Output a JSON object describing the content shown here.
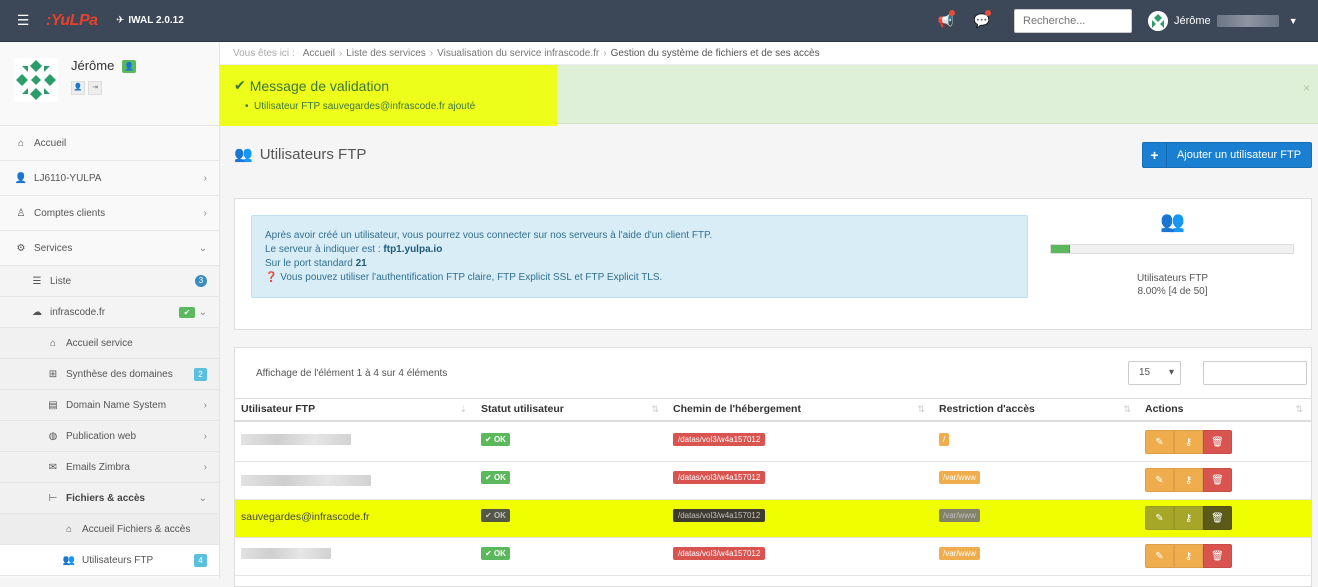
{
  "topbar": {
    "logo_text": ":YuLPa",
    "version": "IWAL 2.0.12",
    "search_placeholder": "Recherche...",
    "user_name": "Jérôme"
  },
  "sidebar": {
    "profile_name": "Jérôme",
    "items": [
      {
        "label": "Accueil",
        "icon": "home-icon"
      },
      {
        "label": "LJ6110-YULPA",
        "icon": "user-icon"
      },
      {
        "label": "Comptes clients",
        "icon": "person-icon"
      },
      {
        "label": "Services",
        "icon": "cogs-icon"
      },
      {
        "label": "Liste",
        "icon": "list-icon",
        "badge": "3"
      },
      {
        "label": "infrascode.fr",
        "icon": "cloud-icon"
      },
      {
        "label": "Accueil service",
        "icon": "home-icon"
      },
      {
        "label": "Synthèse des domaines",
        "icon": "sitemap-icon",
        "badge": "2"
      },
      {
        "label": "Domain Name System",
        "icon": "book-icon"
      },
      {
        "label": "Publication web",
        "icon": "globe-icon"
      },
      {
        "label": "Emails Zimbra",
        "icon": "envelope-icon"
      },
      {
        "label": "Fichiers & accès",
        "icon": "tree-icon"
      },
      {
        "label": "Accueil Fichiers & accès",
        "icon": "home-icon"
      },
      {
        "label": "Utilisateurs FTP",
        "icon": "users-icon",
        "badge": "4"
      }
    ]
  },
  "breadcrumb": {
    "prefix": "Vous êtes ici :",
    "items": [
      "Accueil",
      "Liste des services",
      "Visualisation du service infrascode.fr"
    ],
    "current": "Gestion du système de fichiers et de ses accès"
  },
  "alert": {
    "title": "Message de validation",
    "message": "Utilisateur FTP sauvegardes@infrascode.fr ajouté",
    "close": "×"
  },
  "page": {
    "title": "Utilisateurs FTP",
    "add_button": "Ajouter un utilisateur FTP"
  },
  "info": {
    "line1": "Après avoir créé un utilisateur, vous pourrez vous connecter sur nos serveurs à l'aide d'un client FTP.",
    "line2_prefix": "Le serveur à indiquer est :",
    "server": "ftp1.yulpa.io",
    "line3_prefix": "Sur le port standard",
    "port": "21",
    "line4": "Vous pouvez utiliser l'authentification FTP claire, FTP Explicit SSL et FTP Explicit TLS."
  },
  "stat": {
    "label": "Utilisateurs FTP",
    "value": "8.00% [4 de 50]",
    "percent": 8
  },
  "table": {
    "showing": "Affichage de l'élément 1 à 4 sur 4 éléments",
    "page_length": "15",
    "columns": [
      "Utilisateur FTP",
      "Statut utilisateur",
      "Chemin de l'hébergement",
      "Restriction d'accès",
      "Actions"
    ],
    "rows": [
      {
        "user": "",
        "status": "OK",
        "path": "/datas/vol3/w4a157012",
        "restriction": "/"
      },
      {
        "user": "",
        "status": "OK",
        "path": "/datas/vol3/w4a157012",
        "restriction": "/var/www"
      },
      {
        "user": "sauvegardes@infrascode.fr",
        "status": "OK",
        "path": "/datas/vol3/w4a157012",
        "restriction": "/var/www"
      },
      {
        "user": "",
        "status": "OK",
        "path": "/datas/vol3/w4a157012",
        "restriction": "/var/www"
      }
    ]
  }
}
